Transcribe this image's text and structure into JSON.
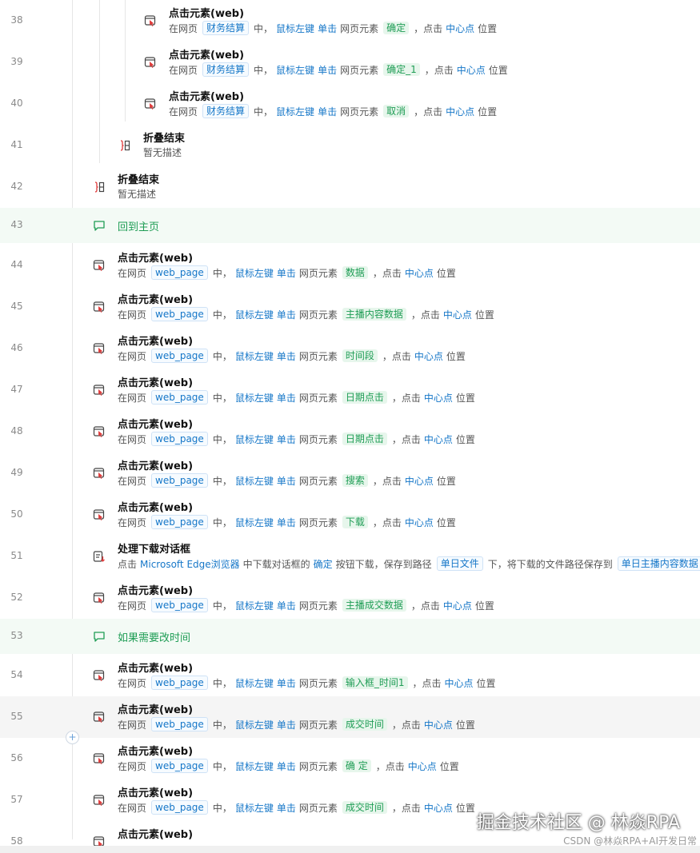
{
  "rows": [
    {
      "n": "38",
      "title": "点击元素(web)",
      "desc": [
        "在网页",
        {
          "var": "财务结算"
        },
        "中，",
        {
          "kw": "鼠标左键"
        },
        {
          "kw": "单击"
        },
        "网页元素",
        {
          "el": "确定"
        },
        "，点击",
        {
          "kw": "中心点"
        },
        "位置"
      ]
    },
    {
      "n": "39",
      "title": "点击元素(web)",
      "desc": [
        "在网页",
        {
          "var": "财务结算"
        },
        "中，",
        {
          "kw": "鼠标左键"
        },
        {
          "kw": "单击"
        },
        "网页元素",
        {
          "el": "确定_1"
        },
        "，点击",
        {
          "kw": "中心点"
        },
        "位置"
      ]
    },
    {
      "n": "40",
      "title": "点击元素(web)",
      "desc": [
        "在网页",
        {
          "var": "财务结算"
        },
        "中，",
        {
          "kw": "鼠标左键"
        },
        {
          "kw": "单击"
        },
        "网页元素",
        {
          "el": "取消"
        },
        "，点击",
        {
          "kw": "中心点"
        },
        "位置"
      ]
    },
    {
      "n": "41",
      "title": "折叠结束",
      "desc": [
        "暂无描述"
      ]
    },
    {
      "n": "42",
      "title": "折叠结束",
      "desc": [
        "暂无描述"
      ]
    },
    {
      "n": "43",
      "comment": "回到主页"
    },
    {
      "n": "44",
      "title": "点击元素(web)",
      "desc": [
        "在网页",
        {
          "var": "web_page"
        },
        "中，",
        {
          "kw": "鼠标左键"
        },
        {
          "kw": "单击"
        },
        "网页元素",
        {
          "el": "数据"
        },
        "，点击",
        {
          "kw": "中心点"
        },
        "位置"
      ]
    },
    {
      "n": "45",
      "title": "点击元素(web)",
      "desc": [
        "在网页",
        {
          "var": "web_page"
        },
        "中，",
        {
          "kw": "鼠标左键"
        },
        {
          "kw": "单击"
        },
        "网页元素",
        {
          "el": "主播内容数据"
        },
        "，点击",
        {
          "kw": "中心点"
        },
        "位置"
      ]
    },
    {
      "n": "46",
      "title": "点击元素(web)",
      "desc": [
        "在网页",
        {
          "var": "web_page"
        },
        "中，",
        {
          "kw": "鼠标左键"
        },
        {
          "kw": "单击"
        },
        "网页元素",
        {
          "el": "时间段"
        },
        "，点击",
        {
          "kw": "中心点"
        },
        "位置"
      ]
    },
    {
      "n": "47",
      "title": "点击元素(web)",
      "desc": [
        "在网页",
        {
          "var": "web_page"
        },
        "中，",
        {
          "kw": "鼠标左键"
        },
        {
          "kw": "单击"
        },
        "网页元素",
        {
          "el": "日期点击"
        },
        "，点击",
        {
          "kw": "中心点"
        },
        "位置"
      ]
    },
    {
      "n": "48",
      "title": "点击元素(web)",
      "desc": [
        "在网页",
        {
          "var": "web_page"
        },
        "中，",
        {
          "kw": "鼠标左键"
        },
        {
          "kw": "单击"
        },
        "网页元素",
        {
          "el": "日期点击"
        },
        "，点击",
        {
          "kw": "中心点"
        },
        "位置"
      ]
    },
    {
      "n": "49",
      "title": "点击元素(web)",
      "desc": [
        "在网页",
        {
          "var": "web_page"
        },
        "中，",
        {
          "kw": "鼠标左键"
        },
        {
          "kw": "单击"
        },
        "网页元素",
        {
          "el": "搜索"
        },
        "，点击",
        {
          "kw": "中心点"
        },
        "位置"
      ]
    },
    {
      "n": "50",
      "title": "点击元素(web)",
      "desc": [
        "在网页",
        {
          "var": "web_page"
        },
        "中，",
        {
          "kw": "鼠标左键"
        },
        {
          "kw": "单击"
        },
        "网页元素",
        {
          "el": "下载"
        },
        "，点击",
        {
          "kw": "中心点"
        },
        "位置"
      ]
    },
    {
      "n": "51",
      "title": "处理下载对话框",
      "desc": [
        "点击",
        {
          "kw": "Microsoft Edge浏览器"
        },
        "中下载对话框的",
        {
          "kw": "确定"
        },
        "按钮下载，保存到路径",
        {
          "var": "单日文件"
        },
        "下，将下载的文件路径保存到",
        {
          "var": "单日主播内容数据"
        }
      ]
    },
    {
      "n": "52",
      "title": "点击元素(web)",
      "desc": [
        "在网页",
        {
          "var": "web_page"
        },
        "中，",
        {
          "kw": "鼠标左键"
        },
        {
          "kw": "单击"
        },
        "网页元素",
        {
          "el": "主播成交数据"
        },
        "，点击",
        {
          "kw": "中心点"
        },
        "位置"
      ]
    },
    {
      "n": "53",
      "comment": "如果需要改时间"
    },
    {
      "n": "54",
      "title": "点击元素(web)",
      "desc": [
        "在网页",
        {
          "var": "web_page"
        },
        "中，",
        {
          "kw": "鼠标左键"
        },
        {
          "kw": "单击"
        },
        "网页元素",
        {
          "el": "输入框_时间1"
        },
        "，点击",
        {
          "kw": "中心点"
        },
        "位置"
      ]
    },
    {
      "n": "55",
      "title": "点击元素(web)",
      "desc": [
        "在网页",
        {
          "var": "web_page"
        },
        "中，",
        {
          "kw": "鼠标左键"
        },
        {
          "kw": "单击"
        },
        "网页元素",
        {
          "el": "成交时间"
        },
        "，点击",
        {
          "kw": "中心点"
        },
        "位置"
      ]
    },
    {
      "n": "56",
      "title": "点击元素(web)",
      "desc": [
        "在网页",
        {
          "var": "web_page"
        },
        "中，",
        {
          "kw": "鼠标左键"
        },
        {
          "kw": "单击"
        },
        "网页元素",
        {
          "el": "确 定"
        },
        "，点击",
        {
          "kw": "中心点"
        },
        "位置"
      ]
    },
    {
      "n": "57",
      "title": "点击元素(web)",
      "desc": [
        "在网页",
        {
          "var": "web_page"
        },
        "中，",
        {
          "kw": "鼠标左键"
        },
        {
          "kw": "单击"
        },
        "网页元素",
        {
          "el": "成交时间"
        },
        "，点击",
        {
          "kw": "中心点"
        },
        "位置"
      ]
    },
    {
      "n": "58",
      "title": "点击元素(web)",
      "desc": []
    }
  ],
  "add_button_label": "+",
  "watermark": "掘金技术社区 @ 林焱RPA",
  "watermark_sub": "CSDN @林焱RPA+AI开发日常",
  "colors": {
    "keyword": "#1677c8",
    "element_tag": "#1f9d55",
    "comment_bg": "#f3faf5"
  },
  "icons": {
    "click_element": "click-element-icon",
    "fold_end": "fold-end-icon",
    "comment": "comment-icon",
    "download_dialog": "download-dialog-icon"
  }
}
